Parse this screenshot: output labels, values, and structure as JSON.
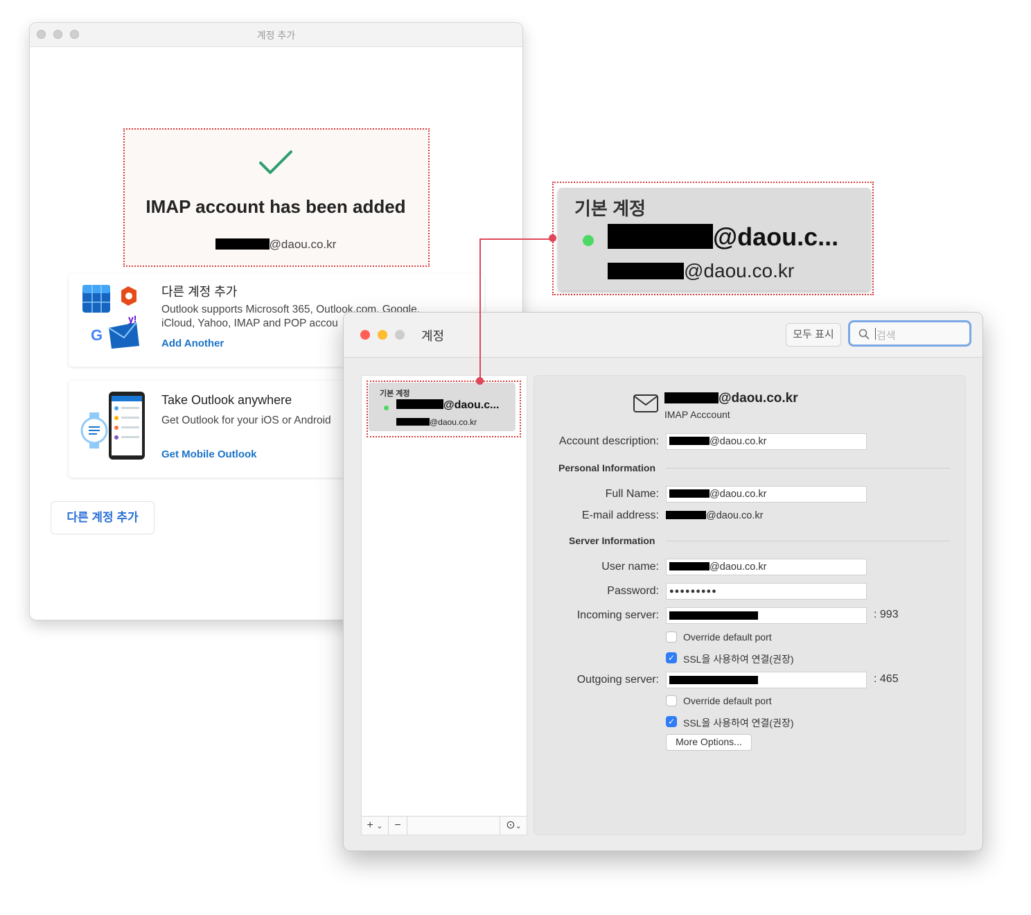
{
  "back_window": {
    "title": "계정 추가",
    "success": {
      "heading": "IMAP account has been added",
      "email_domain": "@daou.co.kr"
    },
    "cards": [
      {
        "title": "다른 계정 추가",
        "line1": "Outlook supports Microsoft 365, Outlook.com, Google,",
        "line2": "iCloud, Yahoo, IMAP and POP accou",
        "link": "Add Another"
      },
      {
        "title": "Take Outlook anywhere",
        "line1": "Get Outlook for your iOS or Android",
        "link": "Get Mobile Outlook"
      }
    ],
    "add_button": "다른 계정 추가"
  },
  "zoom": {
    "heading": "기본 계정",
    "email_short": "@daou.c...",
    "email_full": "@daou.co.kr"
  },
  "front_window": {
    "title": "계정",
    "show_all": "모두 표시",
    "search_placeholder": "검색",
    "sidebar": {
      "heading": "기본 계정",
      "email_short": "@daou.c...",
      "email_full": "@daou.co.kr",
      "add": "+",
      "remove": "−",
      "status_color": "#4cd964"
    },
    "detail": {
      "header_email": "@daou.co.kr",
      "account_type": "IMAP Acccount",
      "account_description_label": "Account description:",
      "account_description_value": "@daou.co.kr",
      "personal_info": "Personal Information",
      "full_name_label": "Full Name:",
      "full_name_value": "@daou.co.kr",
      "email_label": "E-mail address:",
      "email_value": "@daou.co.kr",
      "server_info": "Server Information",
      "user_name_label": "User name:",
      "user_name_value": "@daou.co.kr",
      "password_label": "Password:",
      "password_value": "●●●●●●●●●",
      "incoming_label": "Incoming server:",
      "incoming_port": ": 993",
      "override1": "Override default port",
      "ssl1": "SSL을 사용하여 연결(권장)",
      "outgoing_label": "Outgoing server:",
      "outgoing_port": ": 465",
      "override2": "Override default port",
      "ssl2": "SSL을 사용하여 연결(권장)",
      "more_options": "More Options..."
    }
  },
  "colors": {
    "accent_blue": "#1a73c8",
    "callout_red": "#d63a3a",
    "checkmark_green": "#2e9e6e",
    "traffic_red": "#ff5f57",
    "traffic_yellow": "#febc2e"
  }
}
